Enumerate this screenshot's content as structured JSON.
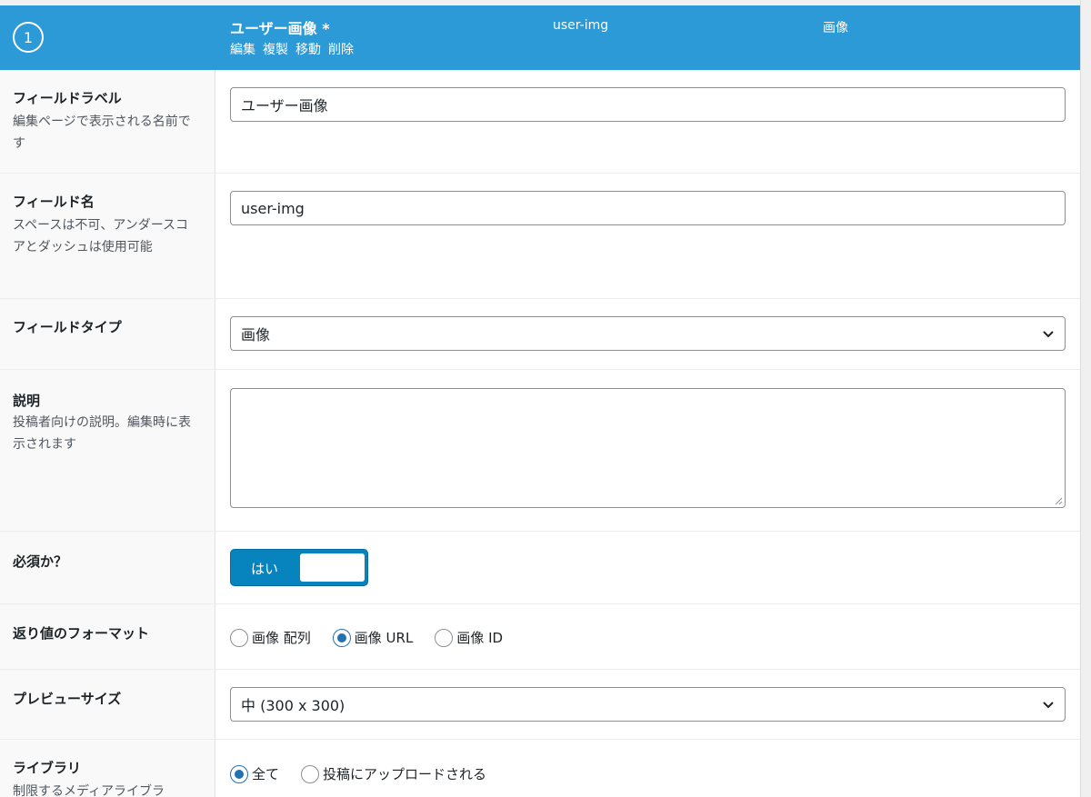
{
  "header": {
    "order": "1",
    "label": "ユーザー画像 *",
    "actions": [
      "編集",
      "複製",
      "移動",
      "削除"
    ],
    "name": "user-img",
    "type": "画像"
  },
  "fields": {
    "label": {
      "title": "フィールドラベル",
      "desc": "編集ページで表示される名前です",
      "value": "ユーザー画像"
    },
    "name": {
      "title": "フィールド名",
      "desc": "スペースは不可、アンダースコアとダッシュは使用可能",
      "value": "user-img"
    },
    "type": {
      "title": "フィールドタイプ",
      "value": "画像"
    },
    "instructions": {
      "title": "説明",
      "desc": "投稿者向けの説明。編集時に表示されます",
      "value": ""
    },
    "required": {
      "title": "必須か？",
      "toggle_label": "はい",
      "on": true
    },
    "return_format": {
      "title": "返り値のフォーマット",
      "options": [
        "画像 配列",
        "画像 URL",
        "画像 ID"
      ],
      "selected": "画像 URL"
    },
    "preview_size": {
      "title": "プレビューサイズ",
      "value": "中 (300 x 300)"
    },
    "library": {
      "title": "ライブラリ",
      "desc": "制限するメディアライブラ",
      "options": [
        "全て",
        "投稿にアップロードされる"
      ],
      "selected": "全て"
    }
  },
  "colors": {
    "header_bg": "#2b9ad6",
    "toggle_on": "#0783be",
    "radio_checked": "#2271b1"
  }
}
